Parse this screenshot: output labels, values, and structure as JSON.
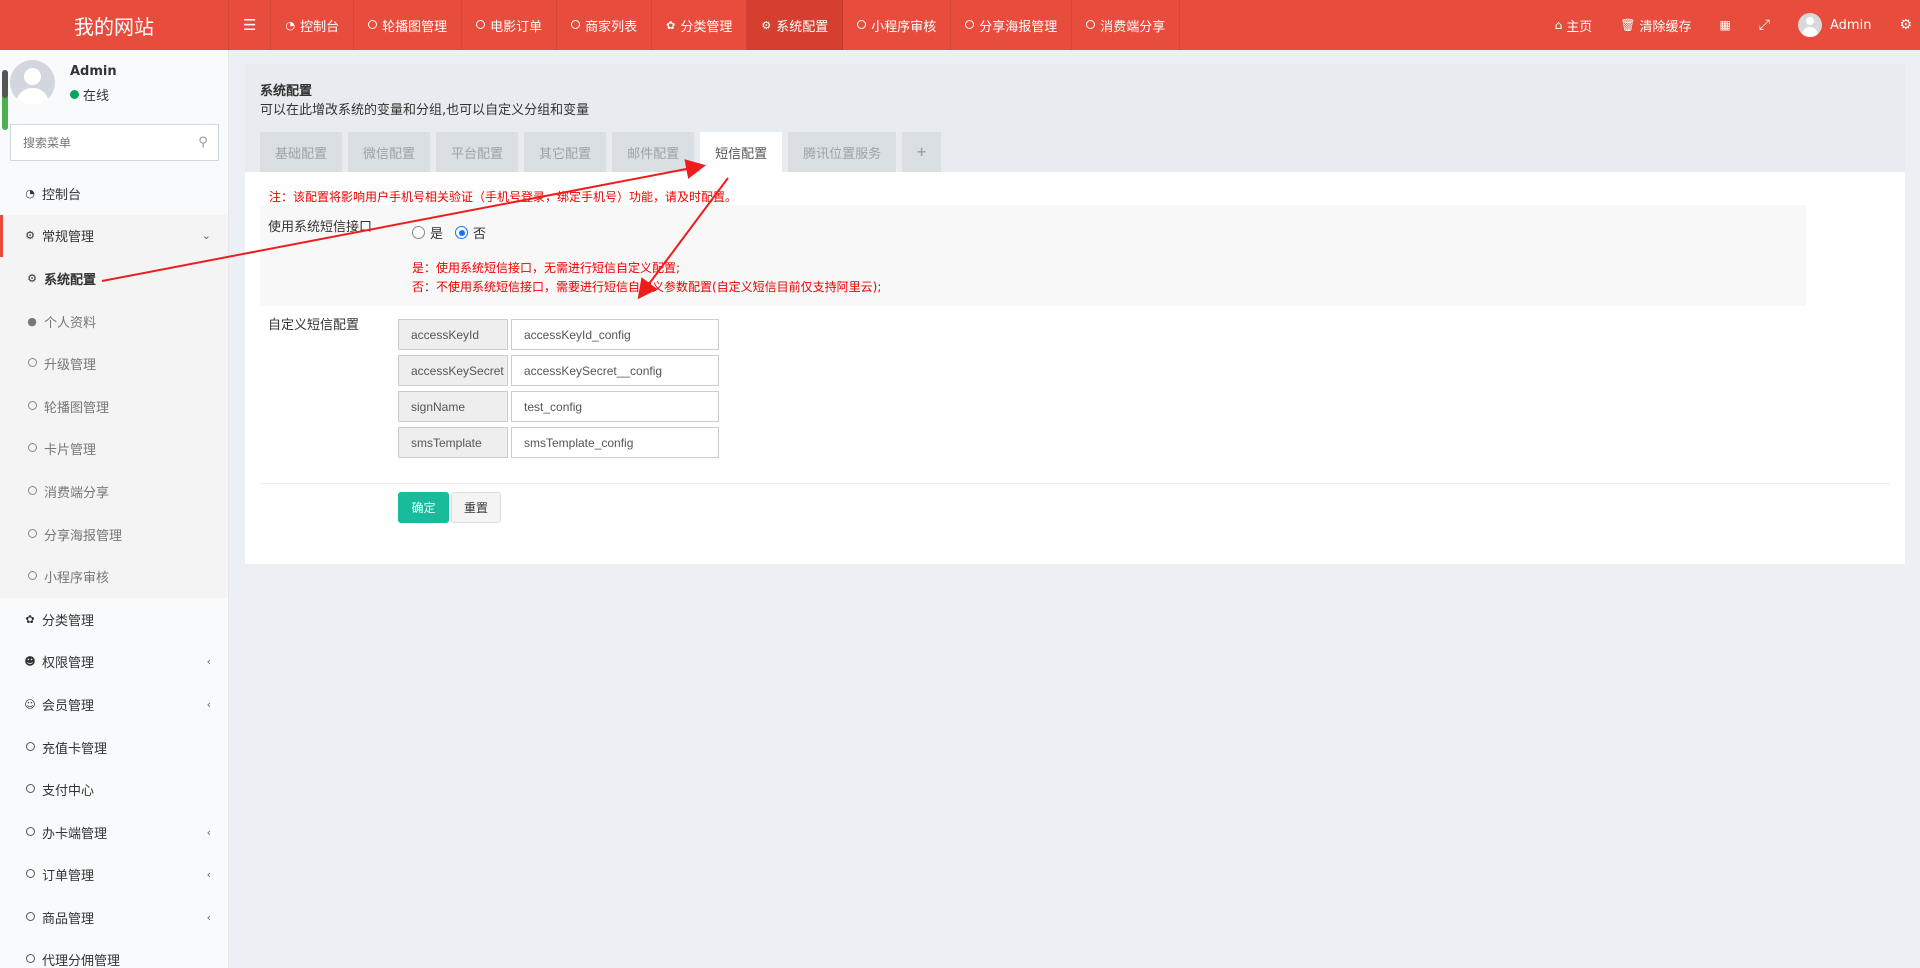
{
  "header": {
    "logo": "我的网站",
    "menu_toggle_icon": "bars-icon",
    "nav": [
      {
        "label": "控制台",
        "icon": "dashboard-icon"
      },
      {
        "label": "轮播图管理",
        "icon": "circle-icon"
      },
      {
        "label": "电影订单",
        "icon": "circle-icon"
      },
      {
        "label": "商家列表",
        "icon": "circle-icon"
      },
      {
        "label": "分类管理",
        "icon": "leaf-icon"
      },
      {
        "label": "系统配置",
        "icon": "gear-icon",
        "active": true
      },
      {
        "label": "小程序审核",
        "icon": "circle-icon"
      },
      {
        "label": "分享海报管理",
        "icon": "circle-icon"
      },
      {
        "label": "消费端分享",
        "icon": "circle-icon"
      }
    ],
    "right": {
      "home": "主页",
      "clear_cache": "清除缓存",
      "user": "Admin"
    }
  },
  "sidebar": {
    "user_name": "Admin",
    "status": "在线",
    "search_placeholder": "搜索菜单",
    "items": [
      {
        "label": "控制台",
        "icon": "dashboard-icon"
      },
      {
        "label": "常规管理",
        "icon": "cogs-icon",
        "expanded": true
      },
      {
        "label": "系统配置",
        "icon": "gear-icon",
        "sub": true,
        "active": true
      },
      {
        "label": "个人资料",
        "icon": "user-icon",
        "sub": true
      },
      {
        "label": "升级管理",
        "icon": "circle-icon",
        "sub": true
      },
      {
        "label": "轮播图管理",
        "icon": "circle-icon",
        "sub": true
      },
      {
        "label": "卡片管理",
        "icon": "circle-icon",
        "sub": true
      },
      {
        "label": "消费端分享",
        "icon": "circle-icon",
        "sub": true
      },
      {
        "label": "分享海报管理",
        "icon": "circle-icon",
        "sub": true
      },
      {
        "label": "小程序审核",
        "icon": "circle-icon",
        "sub": true
      },
      {
        "label": "分类管理",
        "icon": "leaf-icon"
      },
      {
        "label": "权限管理",
        "icon": "users-icon",
        "collapsible": true
      },
      {
        "label": "会员管理",
        "icon": "user-circle-icon",
        "collapsible": true
      },
      {
        "label": "充值卡管理",
        "icon": "circle-icon"
      },
      {
        "label": "支付中心",
        "icon": "circle-icon"
      },
      {
        "label": "办卡端管理",
        "icon": "circle-icon",
        "collapsible": true
      },
      {
        "label": "订单管理",
        "icon": "circle-icon",
        "collapsible": true
      },
      {
        "label": "商品管理",
        "icon": "circle-icon",
        "collapsible": true
      },
      {
        "label": "代理分佣管理",
        "icon": "circle-icon"
      }
    ]
  },
  "main": {
    "title": "系统配置",
    "subtitle": "可以在此增改系统的变量和分组,也可以自定义分组和变量",
    "tabs": [
      "基础配置",
      "微信配置",
      "平台配置",
      "其它配置",
      "邮件配置",
      "短信配置",
      "腾讯位置服务"
    ],
    "active_tab": "短信配置",
    "add_tab": "+",
    "notice": "注：该配置将影响用户手机号相关验证（手机号登录，绑定手机号）功能，请及时配置。",
    "use_system_sms": {
      "label": "使用系统短信接口",
      "options": [
        "是",
        "否"
      ],
      "selected": "否",
      "help_yes": "是：使用系统短信接口，无需进行短信自定义配置;",
      "help_no": "否：不使用系统短信接口，需要进行短信自定义参数配置(自定义短信目前仅支持阿里云);"
    },
    "custom_sms": {
      "label": "自定义短信配置",
      "fields": [
        {
          "key": "accessKeyId",
          "value": "accessKeyId_config"
        },
        {
          "key": "accessKeySecret",
          "value": "accessKeySecret__config"
        },
        {
          "key": "signName",
          "value": "test_config"
        },
        {
          "key": "smsTemplate",
          "value": "smsTemplate_config"
        }
      ]
    },
    "buttons": {
      "submit": "确定",
      "reset": "重置"
    }
  },
  "colors": {
    "brand": "#e74c3c",
    "active_nav": "#d43f2f",
    "primary_button": "#18bc9c",
    "warning_text": "#ee0000",
    "annotation_arrow": "#ee1c1c"
  }
}
